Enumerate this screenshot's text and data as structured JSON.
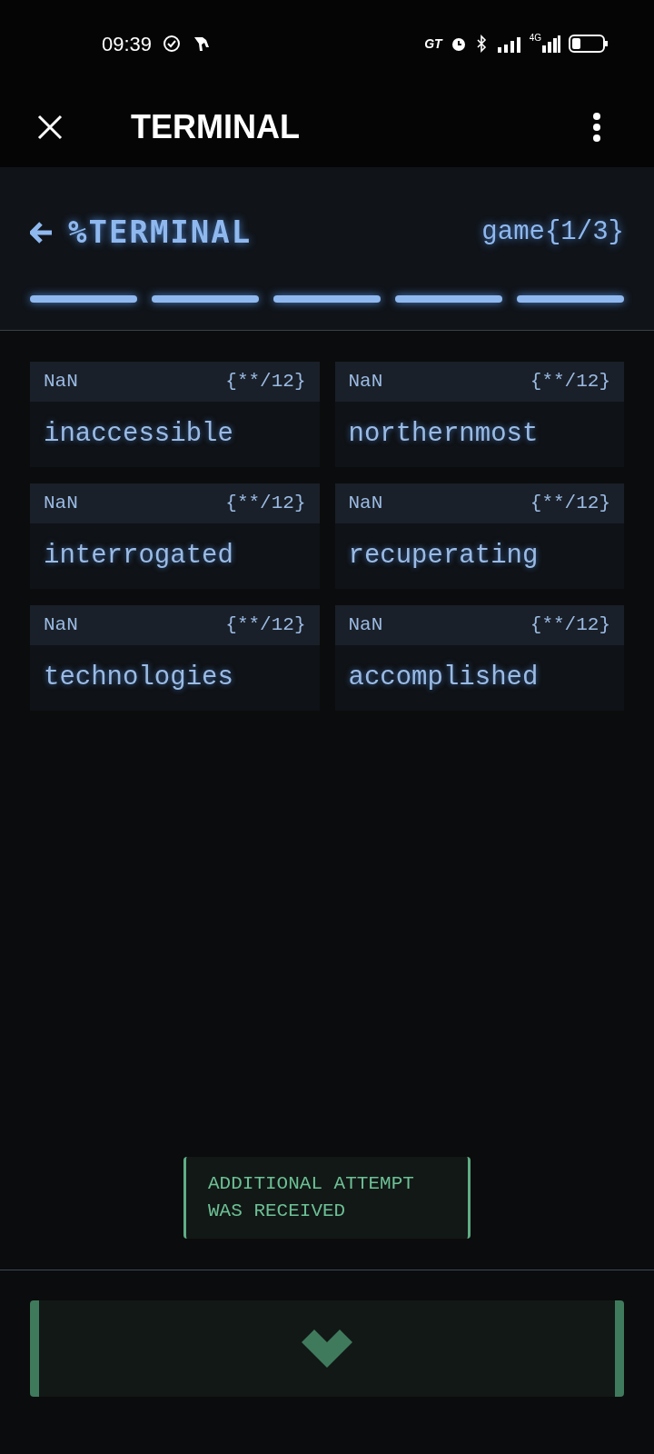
{
  "status_bar": {
    "time": "09:39",
    "carrier_badge": "GT",
    "network": "4G"
  },
  "app_bar": {
    "title": "TERMINAL"
  },
  "header": {
    "title": "%TERMINAL",
    "counter": "game{1/3}",
    "segments": [
      {
        "lit": true
      },
      {
        "lit": true
      },
      {
        "lit": true
      },
      {
        "lit": true
      },
      {
        "lit": true
      }
    ]
  },
  "words": [
    {
      "score": "NaN",
      "match": "{**/12}",
      "word": "inaccessible"
    },
    {
      "score": "NaN",
      "match": "{**/12}",
      "word": "northernmost"
    },
    {
      "score": "NaN",
      "match": "{**/12}",
      "word": "interrogated"
    },
    {
      "score": "NaN",
      "match": "{**/12}",
      "word": "recuperating"
    },
    {
      "score": "NaN",
      "match": "{**/12}",
      "word": "technologies"
    },
    {
      "score": "NaN",
      "match": "{**/12}",
      "word": "accomplished"
    }
  ],
  "toast": {
    "lines": [
      "ADDITIONAL ATTEMPT",
      "WAS RECEIVED"
    ]
  }
}
